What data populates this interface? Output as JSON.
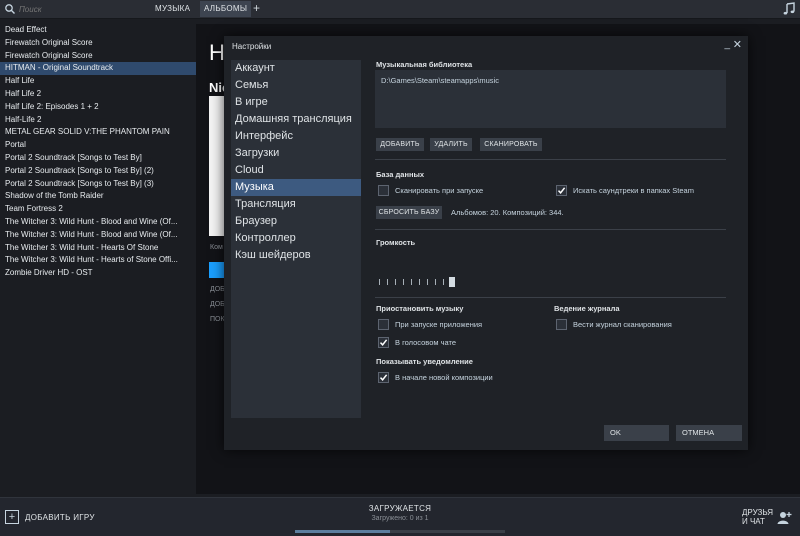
{
  "topbar": {
    "search_placeholder": "Поиск",
    "tabs": [
      {
        "label": "МУЗЫКА"
      },
      {
        "label": "АЛЬБОМЫ"
      }
    ],
    "add_tab": "+"
  },
  "library": {
    "items": [
      {
        "label": "Dead Effect"
      },
      {
        "label": "Firewatch Original Score"
      },
      {
        "label": "Firewatch Original Score"
      },
      {
        "label": "HITMAN - Original Soundtrack"
      },
      {
        "label": "Half Life"
      },
      {
        "label": "Half Life 2"
      },
      {
        "label": "Half Life 2: Episodes 1 + 2"
      },
      {
        "label": "Half-Life 2"
      },
      {
        "label": "METAL GEAR SOLID V:THE PHANTOM PAIN"
      },
      {
        "label": "Portal"
      },
      {
        "label": "Portal 2 Soundtrack [Songs to Test By]"
      },
      {
        "label": "Portal 2 Soundtrack [Songs to Test By] (2)"
      },
      {
        "label": "Portal 2 Soundtrack [Songs to Test By] (3)"
      },
      {
        "label": "Shadow of the Tomb Raider"
      },
      {
        "label": "Team Fortress 2"
      },
      {
        "label": "The Witcher 3: Wild Hunt - Blood and Wine (Of..."
      },
      {
        "label": "The Witcher 3: Wild Hunt - Blood and Wine (Of..."
      },
      {
        "label": "The Witcher 3: Wild Hunt - Hearts Of Stone"
      },
      {
        "label": "The Witcher 3: Wild Hunt - Hearts of Stone Offi..."
      },
      {
        "label": "Zombie Driver HD - OST"
      }
    ],
    "selected_index": 3
  },
  "album_bg": {
    "title": "H",
    "subtitle": "Nic",
    "small1": "Ком",
    "small2": "ДОБ",
    "small3": "ДОБ",
    "small4": "ПОК"
  },
  "dialog": {
    "title": "Настройки",
    "min_label": "_",
    "close_label": "✕",
    "nav": [
      {
        "label": "Аккаунт"
      },
      {
        "label": "Семья"
      },
      {
        "label": "В игре"
      },
      {
        "label": "Домашняя трансляция"
      },
      {
        "label": "Интерфейс"
      },
      {
        "label": "Загрузки"
      },
      {
        "label": "Cloud"
      },
      {
        "label": "Музыка"
      },
      {
        "label": "Трансляция"
      },
      {
        "label": "Браузер"
      },
      {
        "label": "Контроллер"
      },
      {
        "label": "Кэш шейдеров"
      }
    ],
    "active_nav": 7,
    "music": {
      "library_label": "Музыкальная библиотека",
      "path": "D:\\Games\\Steam\\steamapps\\music",
      "add_btn": "ДОБАВИТЬ",
      "remove_btn": "УДАЛИТЬ",
      "scan_btn": "СКАНИРОВАТЬ",
      "db_label": "База данных",
      "scan_on_start": {
        "label": "Сканировать при запуске",
        "checked": false
      },
      "find_soundtracks": {
        "label": "Искать саундтреки в папках Steam",
        "checked": true
      },
      "reset_db_btn": "СБРОСИТЬ БАЗУ",
      "db_info": "Альбомов: 20. Композиций: 344.",
      "volume_label": "Громкость",
      "volume_level": 1.0,
      "pause_label": "Приостановить музыку",
      "pause_on_app": {
        "label": "При запуске приложения",
        "checked": false
      },
      "pause_on_voice": {
        "label": "В голосовом чате",
        "checked": true
      },
      "log_label": "Ведение журнала",
      "log_scan": {
        "label": "Вести журнал сканирования",
        "checked": false
      },
      "notify_label": "Показывать уведомление",
      "notify_new_track": {
        "label": "В начале новой композиции",
        "checked": true
      }
    },
    "ok_btn": "OK",
    "cancel_btn": "ОТМЕНА"
  },
  "bottombar": {
    "add_game": "ДОБАВИТЬ ИГРУ",
    "downloads_title": "ЗАГРУЖАЕТСЯ",
    "downloads_sub": "Загружено: 0 из 1",
    "downloads_progress": 0.45,
    "friends_line1": "ДРУЗЬЯ",
    "friends_line2": "И ЧАТ"
  },
  "colors": {
    "accent": "#3d5a80",
    "selected_row": "#2f4a6d",
    "dialog_bg": "#1f2227"
  }
}
